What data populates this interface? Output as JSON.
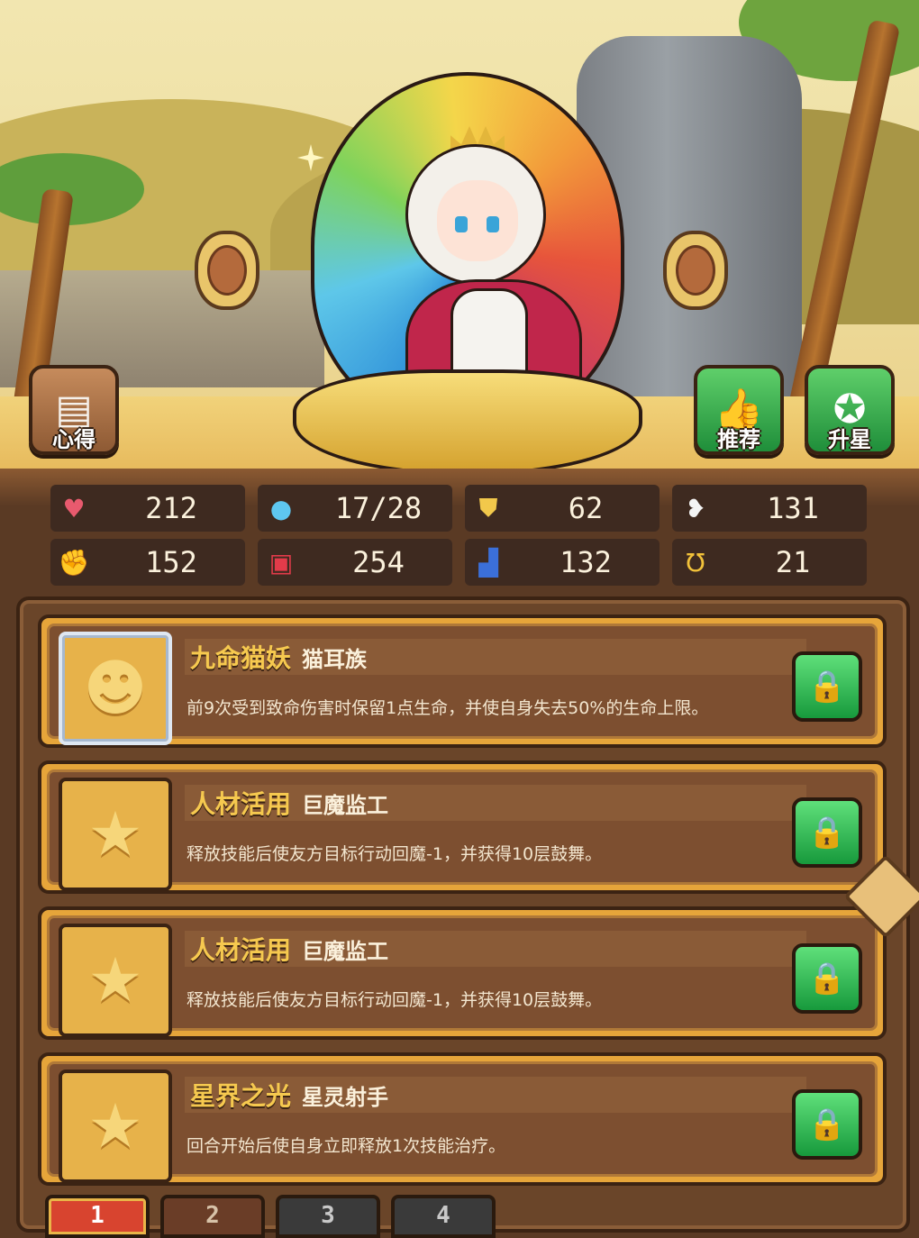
{
  "buttons": {
    "notes": {
      "label": "心得",
      "icon": "scroll-icon"
    },
    "recommend": {
      "label": "推荐",
      "icon": "thumbs-up-icon"
    },
    "upstar": {
      "label": "升星",
      "icon": "star-icon"
    }
  },
  "stats": [
    {
      "icon": "heart-icon",
      "symbol": "♥",
      "color": "#e85a6e",
      "value": "212"
    },
    {
      "icon": "water-drop-icon",
      "symbol": "💧",
      "color": "#5ec7f0",
      "value": "17/28"
    },
    {
      "icon": "shield-icon",
      "symbol": "⛊",
      "color": "#f2c84b",
      "value": "62"
    },
    {
      "icon": "wing-icon",
      "symbol": "❥",
      "color": "#f4f4f4",
      "value": "131"
    },
    {
      "icon": "fist-icon",
      "symbol": "✊",
      "color": "#e89a8a",
      "value": "152"
    },
    {
      "icon": "spellbook-icon",
      "symbol": "📖",
      "color": "#e33b4a",
      "value": "254"
    },
    {
      "icon": "boot-icon",
      "symbol": "▟",
      "color": "#3b6fd8",
      "value": "132"
    },
    {
      "icon": "horseshoe-icon",
      "symbol": "Ʊ",
      "color": "#f2c23a",
      "value": "21"
    }
  ],
  "skills": [
    {
      "name": "九命猫妖",
      "tag": "猫耳族",
      "desc": "前9次受到致命伤害时保留1点生命，并使自身失去50%的生命上限。",
      "icon": "cat-face-icon",
      "glyph": "😺"
    },
    {
      "name": "人材活用",
      "tag": "巨魔监工",
      "desc": "释放技能后使友方目标行动回魔-1，并获得10层鼓舞。",
      "icon": "star-icon",
      "glyph": "★"
    },
    {
      "name": "人材活用",
      "tag": "巨魔监工",
      "desc": "释放技能后使友方目标行动回魔-1，并获得10层鼓舞。",
      "icon": "star-icon",
      "glyph": "★"
    },
    {
      "name": "星界之光",
      "tag": "星灵射手",
      "desc": "回合开始后使自身立即释放1次技能治疗。",
      "icon": "star-icon",
      "glyph": "★"
    }
  ],
  "lock_icon": "lock-icon",
  "tabs": [
    "1",
    "2",
    "3",
    "4"
  ]
}
